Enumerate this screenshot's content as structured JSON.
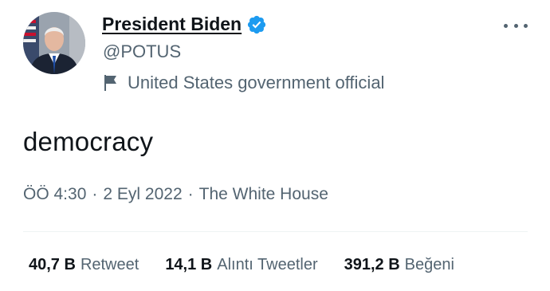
{
  "tweet": {
    "author": {
      "display_name": "President Biden",
      "handle": "@POTUS",
      "verified": true,
      "label": "United States government official",
      "label_icon": "flag-icon",
      "avatar": "avatar-image"
    },
    "text": "democracy",
    "meta": {
      "time": "ÖÖ 4:30",
      "separator": "·",
      "date": "2 Eyl 2022",
      "source": "The White House"
    },
    "stats": [
      {
        "value": "40,7 B",
        "label": "Retweet"
      },
      {
        "value": "14,1 B",
        "label": "Alıntı Tweetler"
      },
      {
        "value": "391,2 B",
        "label": "Beğeni"
      }
    ]
  },
  "colors": {
    "text_primary": "#0f1419",
    "text_secondary": "#536471",
    "verified_badge": "#1d9bf0",
    "divider": "#eff3f4"
  },
  "icons": {
    "verified": "verified-badge-icon",
    "more": "more-options-icon",
    "flag": "flag-icon"
  }
}
